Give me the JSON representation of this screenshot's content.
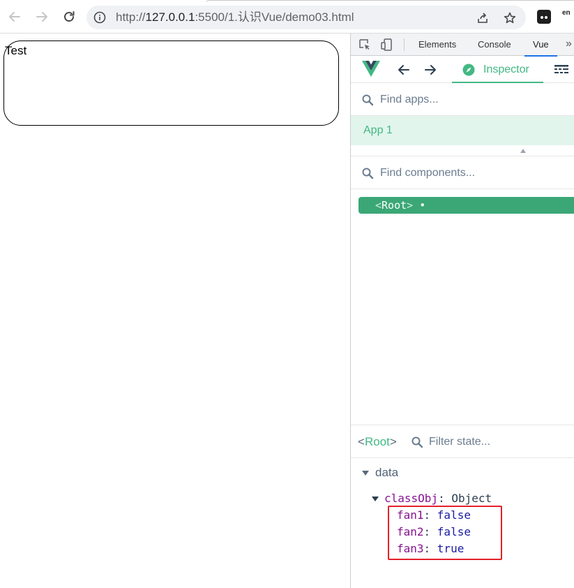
{
  "browser": {
    "url_scheme": "http://",
    "url_host": "127.0.0.1",
    "url_rest": ":5500/1.认识Vue/demo03.html",
    "extension_label": "en"
  },
  "page": {
    "box_text": "Test"
  },
  "devtools": {
    "tabs": [
      {
        "label": "Elements"
      },
      {
        "label": "Console"
      },
      {
        "label": "Vue"
      }
    ],
    "more_label": "»",
    "vue": {
      "inspector_label": "Inspector",
      "find_apps_placeholder": "Find apps...",
      "app_name": "App 1",
      "find_components_placeholder": "Find components...",
      "root_component": {
        "open": "<",
        "name": "Root",
        "close": ">",
        "dot": "•"
      },
      "selected_component": {
        "open": "<",
        "name": "Root",
        "close": ">"
      },
      "filter_state_placeholder": "Filter state...",
      "state": {
        "section": "data",
        "object_key": "classObj",
        "object_type": "Object",
        "props": [
          {
            "key": "fan1",
            "value": "false"
          },
          {
            "key": "fan2",
            "value": "false"
          },
          {
            "key": "fan3",
            "value": "true"
          }
        ]
      }
    }
  },
  "colors": {
    "vue_green": "#42b883",
    "root_row_bg": "#3ba776",
    "highlight_red": "#e3202a",
    "devtools_active_tab": "#1a73e8"
  }
}
